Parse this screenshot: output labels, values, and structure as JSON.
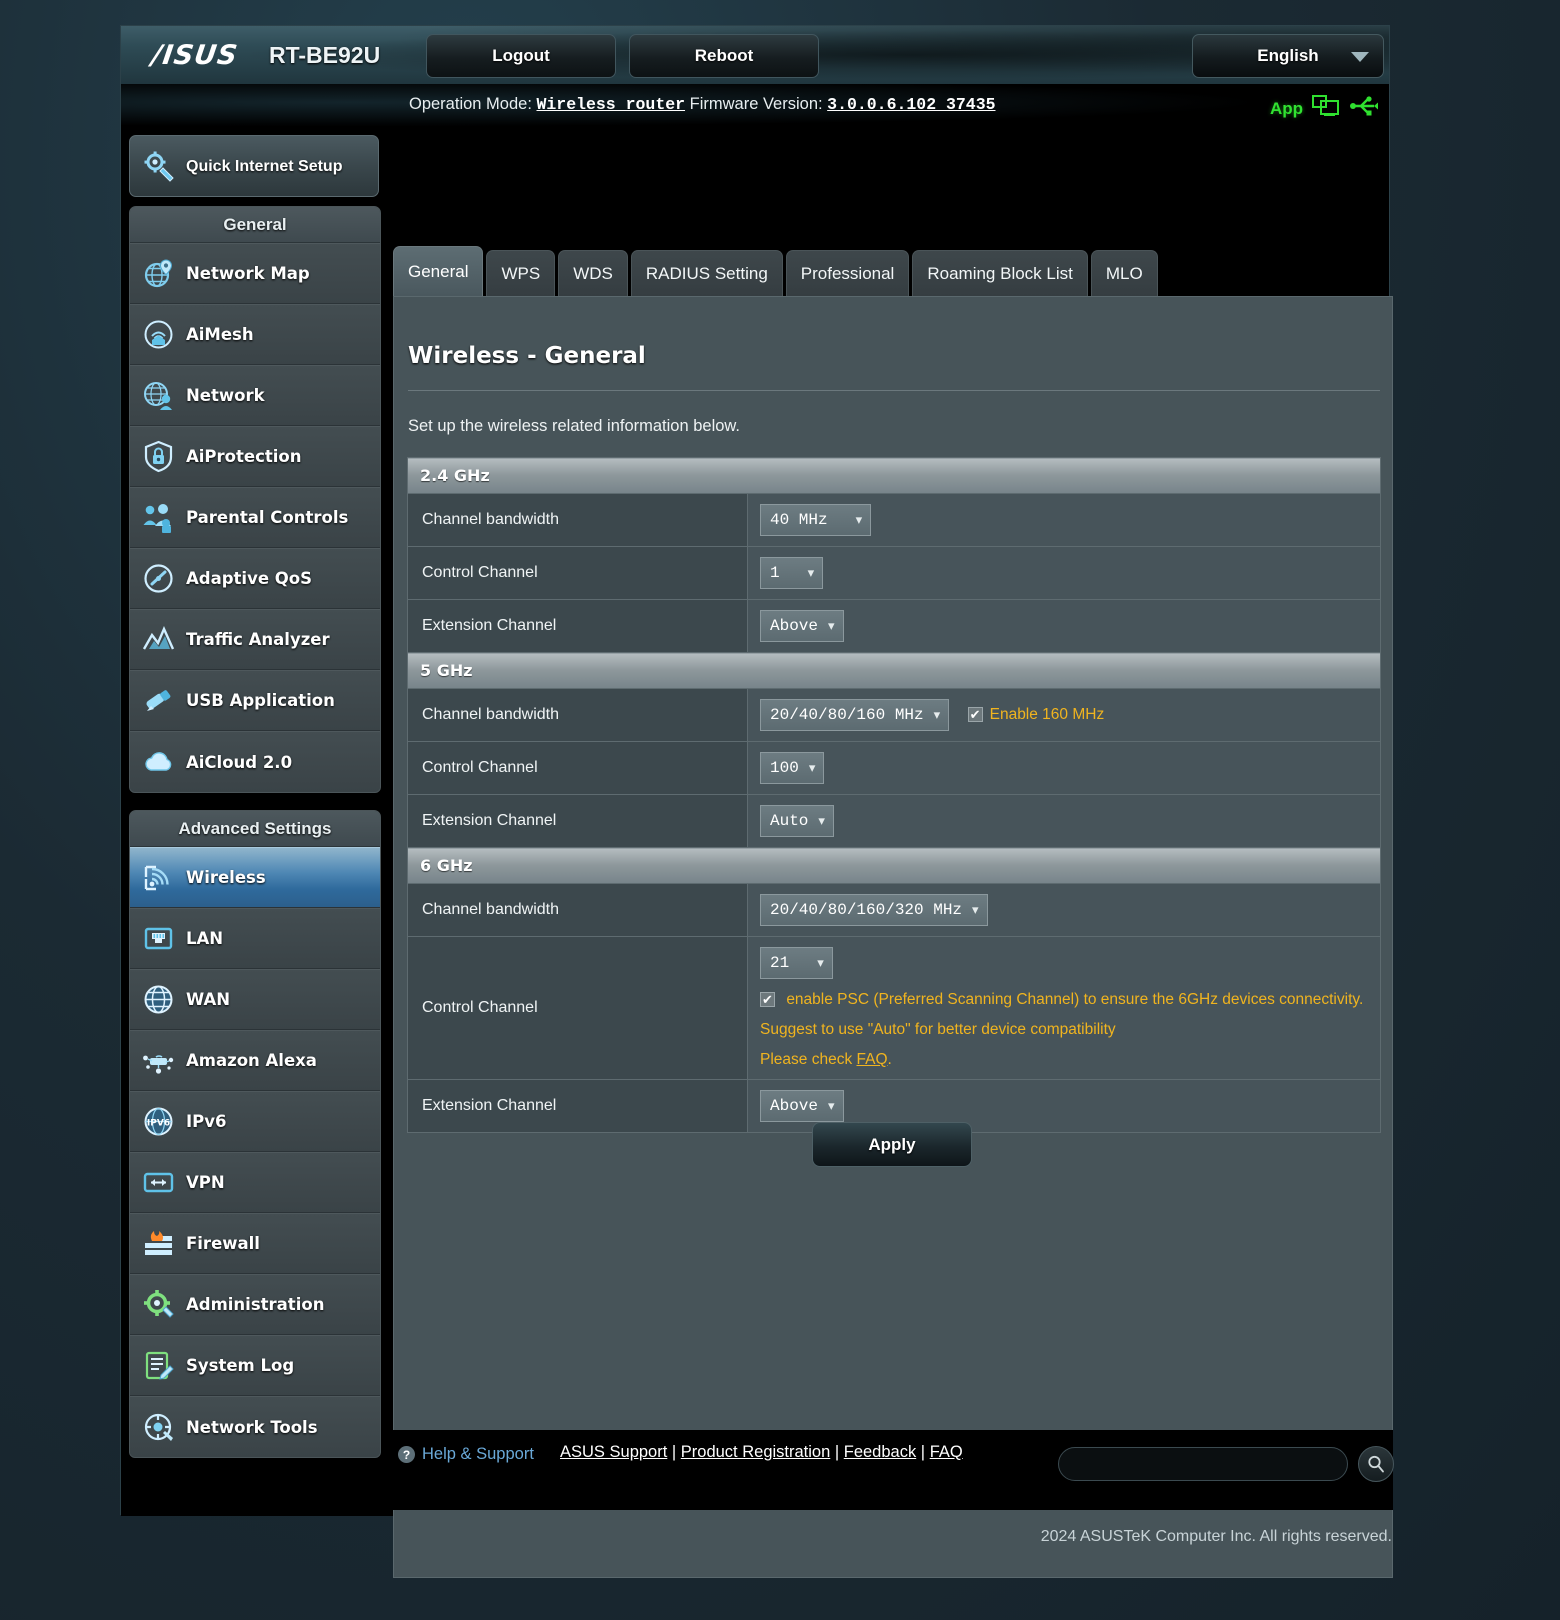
{
  "header": {
    "logo_text": "/ISUS",
    "model": "RT-BE92U",
    "logout_label": "Logout",
    "reboot_label": "Reboot",
    "language": "English",
    "operation_mode_label": "Operation Mode:",
    "operation_mode_value": "Wireless router",
    "firmware_label": "Firmware Version:",
    "firmware_value": "3.0.0.6.102_37435",
    "app_label": "App"
  },
  "sidebar": {
    "quick_setup": "Quick Internet Setup",
    "general_header": "General",
    "general_items": [
      {
        "label": "Network Map",
        "icon": "network-map-icon"
      },
      {
        "label": "AiMesh",
        "icon": "aimesh-icon"
      },
      {
        "label": "Network",
        "icon": "network-icon"
      },
      {
        "label": "AiProtection",
        "icon": "shield-lock-icon"
      },
      {
        "label": "Parental Controls",
        "icon": "parental-controls-icon"
      },
      {
        "label": "Adaptive QoS",
        "icon": "gauge-icon"
      },
      {
        "label": "Traffic Analyzer",
        "icon": "traffic-analyzer-icon"
      },
      {
        "label": "USB Application",
        "icon": "usb-application-icon"
      },
      {
        "label": "AiCloud 2.0",
        "icon": "cloud-icon"
      }
    ],
    "advanced_header": "Advanced Settings",
    "advanced_items": [
      {
        "label": "Wireless",
        "icon": "wireless-icon",
        "active": true
      },
      {
        "label": "LAN",
        "icon": "lan-port-icon",
        "active": false
      },
      {
        "label": "WAN",
        "icon": "globe-icon",
        "active": false
      },
      {
        "label": "Amazon Alexa",
        "icon": "alexa-icon",
        "active": false
      },
      {
        "label": "IPv6",
        "icon": "ipv6-icon",
        "active": false
      },
      {
        "label": "VPN",
        "icon": "vpn-icon",
        "active": false
      },
      {
        "label": "Firewall",
        "icon": "firewall-icon",
        "active": false
      },
      {
        "label": "Administration",
        "icon": "gear-icon",
        "active": false
      },
      {
        "label": "System Log",
        "icon": "system-log-icon",
        "active": false
      },
      {
        "label": "Network Tools",
        "icon": "network-tools-icon",
        "active": false
      }
    ]
  },
  "tabs": [
    {
      "label": "General",
      "active": true
    },
    {
      "label": "WPS",
      "active": false
    },
    {
      "label": "WDS",
      "active": false
    },
    {
      "label": "RADIUS Setting",
      "active": false
    },
    {
      "label": "Professional",
      "active": false
    },
    {
      "label": "Roaming Block List",
      "active": false
    },
    {
      "label": "MLO",
      "active": false
    }
  ],
  "panel": {
    "title": "Wireless - General",
    "description": "Set up the wireless related information below.",
    "apply_label": "Apply"
  },
  "bands": {
    "b24": {
      "header": "2.4 GHz",
      "channel_bandwidth_label": "Channel bandwidth",
      "channel_bandwidth_value": "40 MHz",
      "control_channel_label": "Control Channel",
      "control_channel_value": "1",
      "extension_channel_label": "Extension Channel",
      "extension_channel_value": "Above"
    },
    "b5": {
      "header": "5 GHz",
      "channel_bandwidth_label": "Channel bandwidth",
      "channel_bandwidth_value": "20/40/80/160 MHz",
      "enable160_label": "Enable 160 MHz",
      "enable160_checked": "✔",
      "control_channel_label": "Control Channel",
      "control_channel_value": "100",
      "extension_channel_label": "Extension Channel",
      "extension_channel_value": "Auto"
    },
    "b6": {
      "header": "6 GHz",
      "channel_bandwidth_label": "Channel bandwidth",
      "channel_bandwidth_value": "20/40/80/160/320 MHz",
      "control_channel_label": "Control Channel",
      "control_channel_value": "21",
      "psc_checked": "✔",
      "psc_text": "enable PSC (Preferred Scanning Channel) to ensure the 6GHz devices connectivity.",
      "psc_note": "Suggest to use \"Auto\" for better device compatibility",
      "psc_faq_prefix": "Please check ",
      "psc_faq_link": "FAQ",
      "psc_faq_suffix": ".",
      "extension_channel_label": "Extension Channel",
      "extension_channel_value": "Above"
    }
  },
  "footer": {
    "help_label": "Help & Support",
    "link_support": "ASUS Support",
    "link_registration": "Product Registration",
    "link_feedback": "Feedback",
    "link_faq": "FAQ",
    "separator": " | ",
    "search_placeholder": "",
    "search_value": "",
    "copyright": "2024 ASUSTeK Computer Inc. All rights reserved."
  },
  "colors": {
    "accent_blue": "#2f6a9c",
    "amber": "#f0b41f",
    "green": "#31e231",
    "panel_bg": "#475459"
  }
}
